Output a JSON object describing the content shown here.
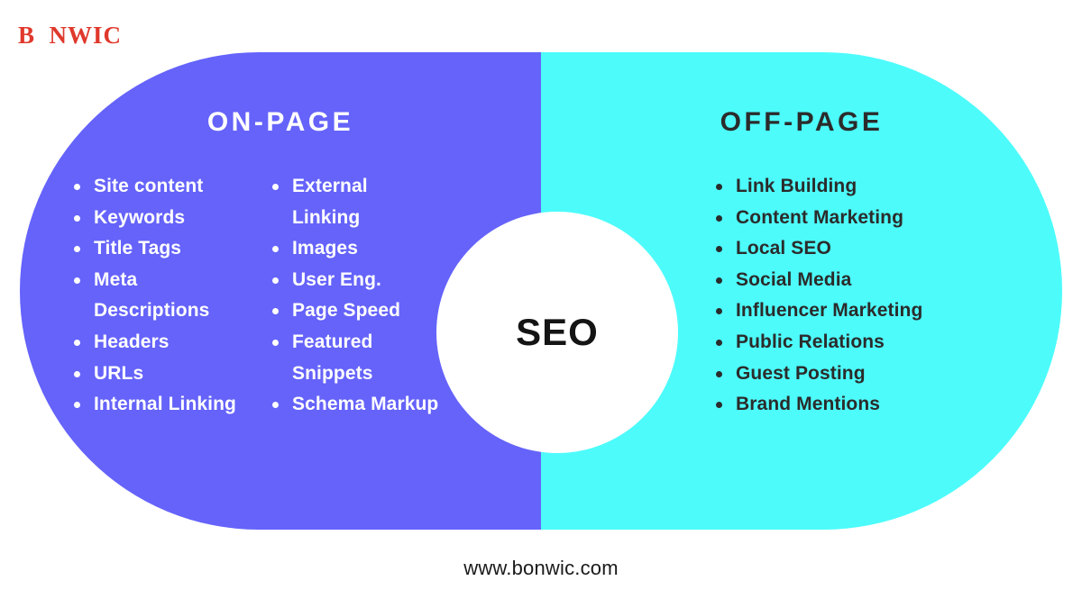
{
  "brand": {
    "logo_text": "B  NWIC",
    "logo_color": "#e0382c"
  },
  "colors": {
    "on_page_background": "#6563fa",
    "off_page_background": "#4dfbfb",
    "circle_background": "#ffffff",
    "dark_text": "#2b2b2b",
    "light_text": "#ffffff"
  },
  "diagram": {
    "center": {
      "label": "SEO"
    },
    "on_page": {
      "heading": "ON-PAGE",
      "column_1": [
        "Site content",
        "Keywords",
        "Title Tags",
        "Meta Descriptions",
        "Headers",
        "URLs",
        "Internal Linking"
      ],
      "column_2": [
        "External Linking",
        "Images",
        "User Eng.",
        "Page Speed",
        "Featured Snippets",
        "Schema Markup"
      ]
    },
    "off_page": {
      "heading": "OFF-PAGE",
      "column_1": [
        "Link Building",
        "Content Marketing",
        "Local SEO",
        "Social Media",
        "Influencer Marketing",
        "Public Relations",
        "Guest Posting",
        "Brand Mentions"
      ]
    }
  },
  "footer": {
    "url": "www.bonwic.com"
  }
}
